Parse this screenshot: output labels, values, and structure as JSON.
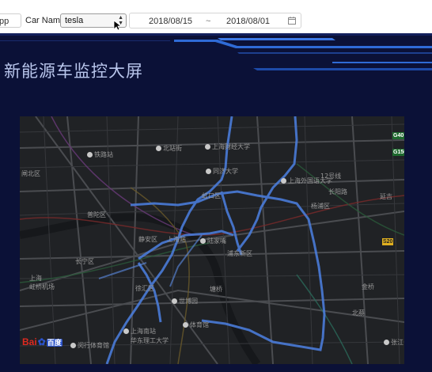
{
  "toolbar": {
    "app_text": "pp",
    "car_name_label": "Car Name:",
    "car_name_value": "tesla",
    "date_start": "2018/08/15",
    "date_separator": "~",
    "date_end": "2018/08/01"
  },
  "dashboard": {
    "title": "新能源车监控大屏",
    "background_color": "#0b1137",
    "accent_color": "#2f6bd6"
  },
  "map": {
    "labels": [
      {
        "text": "铁路站",
        "poi": true
      },
      {
        "text": "北站街",
        "poi": true
      },
      {
        "text": "上海财经大学",
        "poi": true
      },
      {
        "text": "同济大学",
        "poi": true
      },
      {
        "text": "虹口区",
        "poi": false
      },
      {
        "text": "上海外国语大学",
        "poi": true
      },
      {
        "text": "闸北区",
        "poi": false
      },
      {
        "text": "普陀区",
        "poi": false
      },
      {
        "text": "杨浦区",
        "poi": false
      },
      {
        "text": "长阳路",
        "poi": false
      },
      {
        "text": "延吉",
        "poi": false
      },
      {
        "text": "静安区",
        "poi": false
      },
      {
        "text": "上海站",
        "poi": false
      },
      {
        "text": "陆家嘴",
        "poi": true
      },
      {
        "text": "浦东新区",
        "poi": false
      },
      {
        "text": "上海",
        "poi": false
      },
      {
        "text": "虹桥机场",
        "poi": false
      },
      {
        "text": "长宁区",
        "poi": false
      },
      {
        "text": "徐汇区",
        "poi": false
      },
      {
        "text": "世博园",
        "poi": true
      },
      {
        "text": "塘桥",
        "poi": false
      },
      {
        "text": "上海南站",
        "poi": true
      },
      {
        "text": "华东理工大学",
        "poi": false
      },
      {
        "text": "闵行体育馆",
        "poi": true
      },
      {
        "text": "体育馆",
        "poi": true
      },
      {
        "text": "北蔡",
        "poi": false
      },
      {
        "text": "张江",
        "poi": false
      },
      {
        "text": "12号线",
        "poi": false
      },
      {
        "text": "金桥",
        "poi": false
      }
    ],
    "road_signs": [
      "G40",
      "G1501",
      "S20"
    ],
    "logo_text_1": "Bai",
    "logo_text_2": "百度"
  }
}
